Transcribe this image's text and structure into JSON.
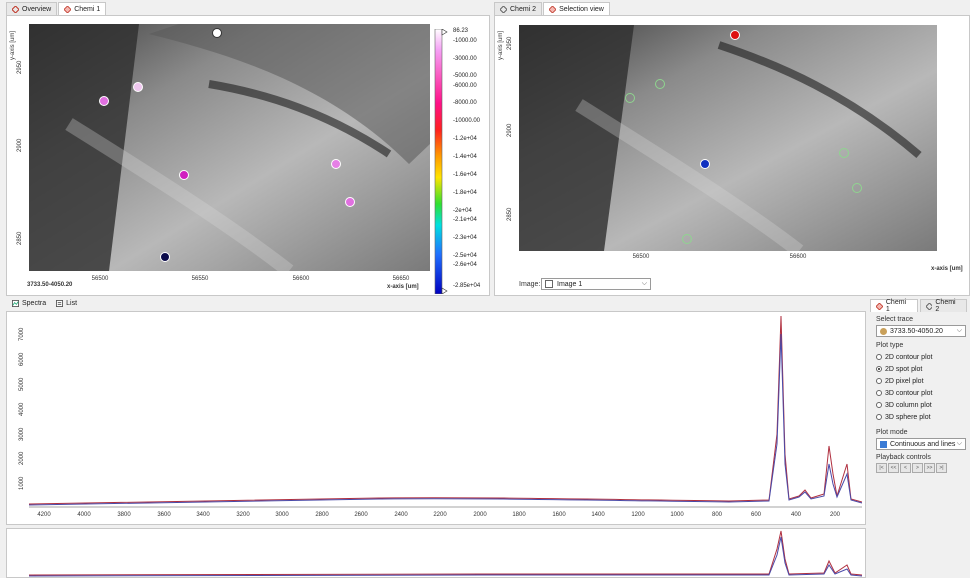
{
  "left_panel": {
    "tabs": [
      {
        "label": "Overview"
      },
      {
        "label": "Chemi 1"
      }
    ],
    "y_axis_label": "y-axis [um]",
    "x_axis_label": "x-axis [um]",
    "y_ticks": [
      "2950",
      "2900",
      "2850"
    ],
    "x_ticks": [
      "56500",
      "56550",
      "56600",
      "56650"
    ],
    "range_label": "3733.50-4050.20",
    "colorbar": [
      "86.23",
      "-1000.00",
      "-3000.00",
      "-5000.00",
      "-6000.00",
      "-8000.00",
      "-10000.00",
      "-1.2e+04",
      "-1.4e+04",
      "-1.6e+04",
      "-1.8e+04",
      "-2e+04",
      "-2.1e+04",
      "-2.3e+04",
      "-2.5e+04",
      "-2.6e+04",
      "-2.85e+04"
    ]
  },
  "right_panel": {
    "tabs": [
      {
        "label": "Chemi 2"
      },
      {
        "label": "Selection view"
      }
    ],
    "y_axis_label": "y-axis [um]",
    "x_axis_label": "x-axis [um]",
    "y_ticks": [
      "2950",
      "2900",
      "2850"
    ],
    "x_ticks": [
      "56500",
      "56600"
    ],
    "image_label": "Image:",
    "image_value": "Image 1"
  },
  "bottom_tabs": [
    {
      "label": "Spectra"
    },
    {
      "label": "List"
    }
  ],
  "spectra": {
    "y_ticks": [
      "7000",
      "6000",
      "5000",
      "4000",
      "3000",
      "2000",
      "1000"
    ],
    "x_ticks": [
      "4200",
      "4000",
      "3800",
      "3600",
      "3400",
      "3200",
      "3000",
      "2800",
      "2600",
      "2400",
      "2200",
      "2000",
      "1800",
      "1600",
      "1400",
      "1200",
      "1000",
      "800",
      "600",
      "400",
      "200"
    ]
  },
  "side": {
    "tabs": [
      {
        "label": "Chemi 1"
      },
      {
        "label": "Chemi 2"
      }
    ],
    "select_trace_label": "Select trace",
    "trace_value": "3733.50-4050.20",
    "plot_type_label": "Plot type",
    "plot_types": [
      {
        "label": "2D contour plot",
        "selected": false
      },
      {
        "label": "2D spot plot",
        "selected": true
      },
      {
        "label": "2D pixel plot",
        "selected": false
      },
      {
        "label": "3D contour plot",
        "selected": false
      },
      {
        "label": "3D column plot",
        "selected": false
      },
      {
        "label": "3D sphere plot",
        "selected": false
      }
    ],
    "plot_mode_label": "Plot mode",
    "plot_mode_value": "Continuous and lines",
    "playback_label": "Playback controls",
    "playback_buttons": [
      "|<",
      "<<",
      "<",
      ">",
      ">>",
      ">|"
    ]
  }
}
